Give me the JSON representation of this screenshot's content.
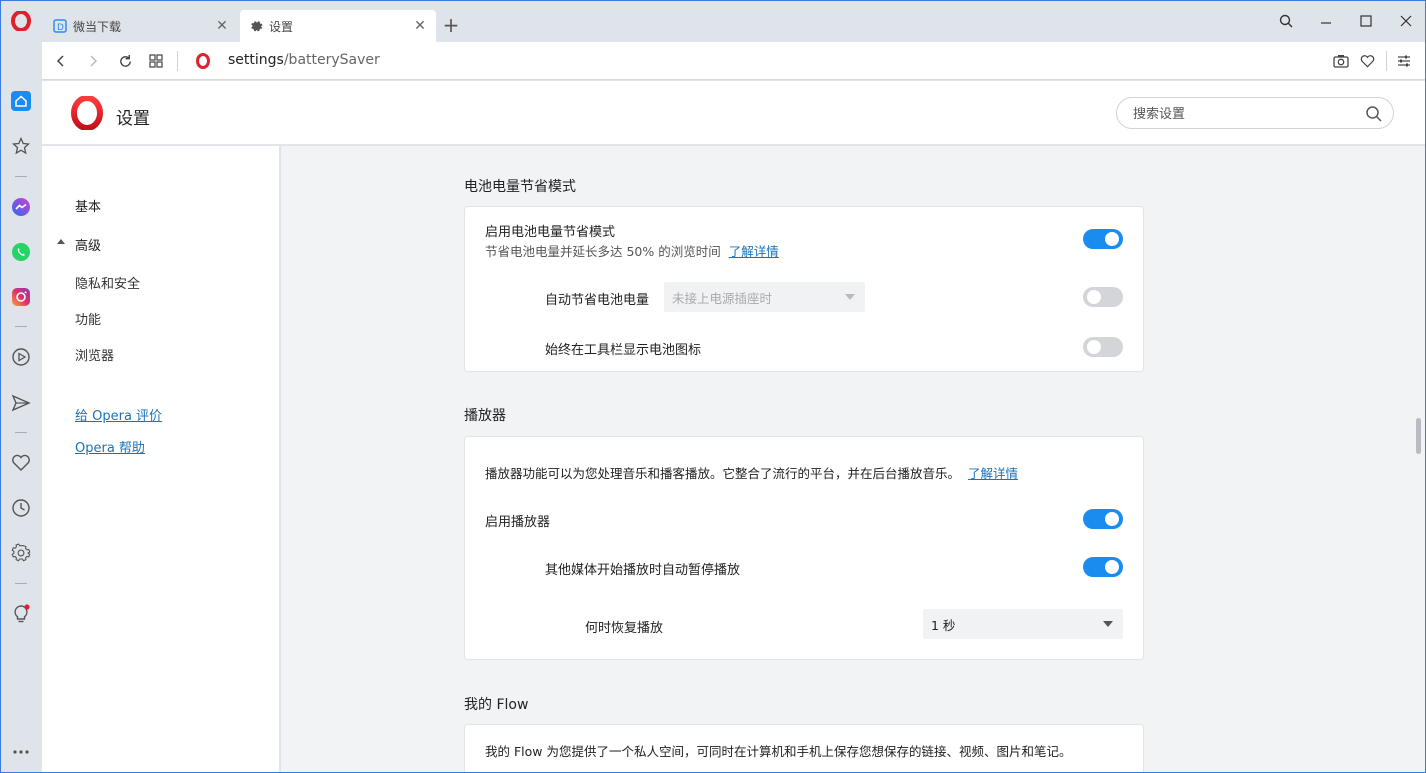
{
  "tabs": [
    {
      "label": "微当下载",
      "active": false
    },
    {
      "label": "设置",
      "active": true
    }
  ],
  "address": {
    "host": "settings",
    "path": "/batterySaver"
  },
  "header": {
    "title": "设置",
    "search_placeholder": "搜索设置"
  },
  "leftnav": {
    "basic": "基本",
    "advanced": "高级",
    "privacy": "隐私和安全",
    "features": "功能",
    "browser": "浏览器",
    "rate": "给 Opera 评价",
    "help": "Opera 帮助"
  },
  "battery": {
    "section_title": "电池电量节省模式",
    "enable_label": "启用电池电量节省模式",
    "enable_desc": "节省电池电量并延长多达 50% 的浏览时间",
    "learn_more": "了解详情",
    "enable_on": true,
    "auto_label": "自动节省电池电量",
    "auto_select": "未接上电源插座时",
    "auto_on": false,
    "icon_label": "始终在工具栏显示电池图标",
    "icon_on": false
  },
  "player": {
    "section_title": "播放器",
    "desc": "播放器功能可以为您处理音乐和播客播放。它整合了流行的平台，并在后台播放音乐。",
    "learn_more": "了解详情",
    "enable_label": "启用播放器",
    "enable_on": true,
    "pause_label": "其他媒体开始播放时自动暂停播放",
    "pause_on": true,
    "resume_label": "何时恢复播放",
    "resume_select": "1 秒"
  },
  "flow": {
    "section_title": "我的 Flow",
    "desc": "我的 Flow 为您提供了一个私人空间，可同时在计算机和手机上保存您想保存的链接、视频、图片和笔记。"
  },
  "colors": {
    "accent": "#1a8cf0",
    "link": "#1a73b8",
    "opera_red": "#e0202c"
  }
}
